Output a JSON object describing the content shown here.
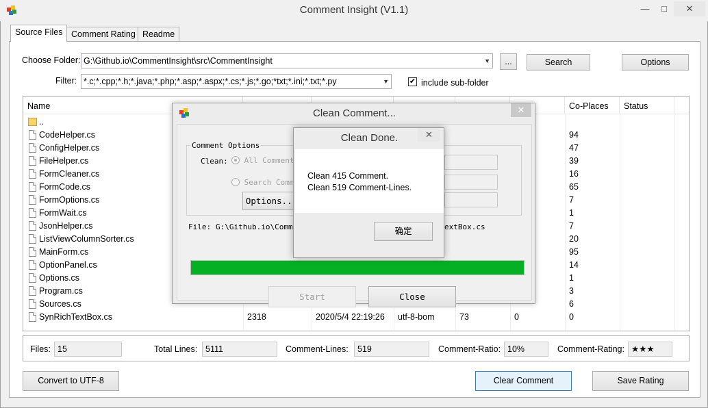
{
  "app": {
    "title": "Comment Insight (V1.1)"
  },
  "window_controls": {
    "minimize": "—",
    "maximize": "□",
    "close": "✕"
  },
  "tabs": [
    {
      "label": "Source Files",
      "active": true
    },
    {
      "label": "Comment Rating",
      "active": false
    },
    {
      "label": "Readme",
      "active": false
    }
  ],
  "source": {
    "choose_folder_label": "Choose Folder:",
    "folder_value": "G:\\Github.io\\CommentInsight\\src\\CommentInsight",
    "browse_label": "...",
    "search_label": "Search",
    "options_label": "Options",
    "filter_label": "Filter:",
    "filter_value": "*.c;*.cpp;*.h;*.java;*.php;*.asp;*.aspx;*.cs;*.js;*.go;*txt;*.ini;*.txt;*.py",
    "include_subfolder_label": "include sub-folder",
    "include_subfolder_checked": true
  },
  "listview": {
    "columns": [
      "Name",
      "",
      "",
      "",
      "nes",
      "Co-Places",
      "Status"
    ],
    "rows": [
      {
        "name": "..",
        "icon": "folder-icon",
        "size": "",
        "modified": "",
        "encoding": "",
        "lines": "",
        "comment_lines": "",
        "co_places": ""
      },
      {
        "name": "CodeHelper.cs",
        "icon": "file-icon",
        "size": "",
        "modified": "",
        "encoding": "",
        "lines": "",
        "comment_lines": "",
        "co_places": "94"
      },
      {
        "name": "ConfigHelper.cs",
        "icon": "file-icon",
        "size": "",
        "modified": "",
        "encoding": "",
        "lines": "",
        "comment_lines": "",
        "co_places": "47"
      },
      {
        "name": "FileHelper.cs",
        "icon": "file-icon",
        "size": "",
        "modified": "",
        "encoding": "",
        "lines": "",
        "comment_lines": "",
        "co_places": "39"
      },
      {
        "name": "FormCleaner.cs",
        "icon": "file-icon",
        "size": "",
        "modified": "",
        "encoding": "",
        "lines": "",
        "comment_lines": "",
        "co_places": "16"
      },
      {
        "name": "FormCode.cs",
        "icon": "file-icon",
        "size": "",
        "modified": "",
        "encoding": "",
        "lines": "",
        "comment_lines": "",
        "co_places": "65"
      },
      {
        "name": "FormOptions.cs",
        "icon": "file-icon",
        "size": "",
        "modified": "",
        "encoding": "",
        "lines": "",
        "comment_lines": "",
        "co_places": "7"
      },
      {
        "name": "FormWait.cs",
        "icon": "file-icon",
        "size": "",
        "modified": "",
        "encoding": "",
        "lines": "",
        "comment_lines": "",
        "co_places": "1"
      },
      {
        "name": "JsonHelper.cs",
        "icon": "file-icon",
        "size": "",
        "modified": "",
        "encoding": "",
        "lines": "",
        "comment_lines": "",
        "co_places": "7"
      },
      {
        "name": "ListViewColumnSorter.cs",
        "icon": "file-icon",
        "size": "",
        "modified": "",
        "encoding": "",
        "lines": "",
        "comment_lines": "",
        "co_places": "20"
      },
      {
        "name": "MainForm.cs",
        "icon": "file-icon",
        "size": "",
        "modified": "",
        "encoding": "",
        "lines": "",
        "comment_lines": "",
        "co_places": "95"
      },
      {
        "name": "OptionPanel.cs",
        "icon": "file-icon",
        "size": "",
        "modified": "",
        "encoding": "",
        "lines": "",
        "comment_lines": "",
        "co_places": "14"
      },
      {
        "name": "Options.cs",
        "icon": "file-icon",
        "size": "",
        "modified": "",
        "encoding": "",
        "lines": "",
        "comment_lines": "",
        "co_places": "1"
      },
      {
        "name": "Program.cs",
        "icon": "file-icon",
        "size": "",
        "modified": "",
        "encoding": "",
        "lines": "",
        "comment_lines": "",
        "co_places": "3"
      },
      {
        "name": "Sources.cs",
        "icon": "file-icon",
        "size": "",
        "modified": "",
        "encoding": "",
        "lines": "",
        "comment_lines": "",
        "co_places": "6"
      },
      {
        "name": "SynRichTextBox.cs",
        "icon": "file-icon",
        "size": "2318",
        "modified": "2020/5/4 22:19:26",
        "encoding": "utf-8-bom",
        "lines": "73",
        "comment_lines": "0",
        "co_places": "0"
      }
    ]
  },
  "stats": {
    "files_label": "Files:",
    "files_value": "15",
    "total_lines_label": "Total Lines:",
    "total_lines_value": "5111",
    "comment_lines_label": "Comment-Lines:",
    "comment_lines_value": "519",
    "comment_ratio_label": "Comment-Ratio:",
    "comment_ratio_value": "10%",
    "comment_rating_label": "Comment-Rating:",
    "comment_rating_value": "★★★"
  },
  "footer": {
    "convert_label": "Convert to UTF-8",
    "clear_label": "Clear Comment",
    "save_rating_label": "Save Rating"
  },
  "clean_dialog": {
    "title": "Clean Comment...",
    "close_glyph": "✕",
    "group_title": "Comment Options",
    "clean_label": "Clean:",
    "radio_all": "All Comment",
    "radio_search": "Search Commen",
    "options_button": "Options...",
    "file_label": "File:",
    "file_path_left": "G:\\Github.io\\Commen",
    "file_path_right": "extBox.cs",
    "progress_fraction": 1.0,
    "start_label": "Start",
    "close_label": "Close"
  },
  "done_dialog": {
    "title": "Clean Done.",
    "close_glyph": "✕",
    "line1": "Clean 415 Comment.",
    "line2": "Clean 519 Comment-Lines.",
    "ok_label": "确定"
  }
}
